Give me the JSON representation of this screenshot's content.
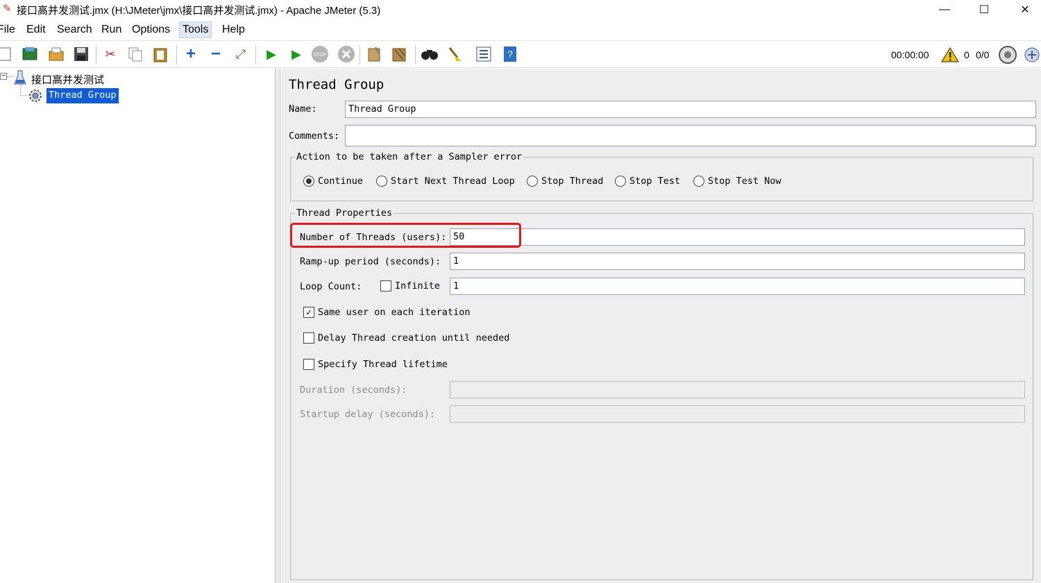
{
  "window": {
    "title": "接口高并发测试.jmx (H:\\JMeter\\jmx\\接口高并发测试.jmx) - Apache JMeter (5.3)",
    "minimize_glyph": "—",
    "maximize_glyph": "☐",
    "close_glyph": "✕"
  },
  "menu": {
    "items": [
      "File",
      "Edit",
      "Search",
      "Run",
      "Options",
      "Tools",
      "Help"
    ],
    "active": "Tools"
  },
  "toolbar": {
    "icons": [
      "new-icon",
      "templates-icon",
      "open-icon",
      "save-icon",
      "cut-icon",
      "copy-icon",
      "paste-icon",
      "expand-icon",
      "collapse-icon",
      "toggle-icon",
      "start-icon",
      "start-no-pauses-icon",
      "stop-icon",
      "shutdown-icon",
      "clear-icon",
      "clear-all-icon",
      "search-icon",
      "reset-search-icon",
      "function-helper-icon",
      "help-icon"
    ],
    "timer": "00:00:00",
    "warning_count": "0",
    "threads_ratio": "0/0",
    "accent_play": "#1a9b1a",
    "accent_add": "#1f5fbf"
  },
  "tree": {
    "root_label": "接口高并发测试",
    "child_label": "Thread Group",
    "selection_color": "#0f5cd6",
    "expander": "−"
  },
  "panel": {
    "heading": "Thread Group",
    "name_label": "Name:",
    "name_value": "Thread Group",
    "comments_label": "Comments:",
    "comments_value": "",
    "sampler_error": {
      "legend": "Action to be taken after a Sampler error",
      "options": [
        "Continue",
        "Start Next Thread Loop",
        "Stop Thread",
        "Stop Test",
        "Stop Test Now"
      ],
      "selected": "Continue"
    },
    "thread_props": {
      "legend": "Thread Properties",
      "num_threads_label": "Number of Threads (users):",
      "num_threads_value": "50",
      "rampup_label": "Ramp-up period (seconds):",
      "rampup_value": "1",
      "loop_label": "Loop Count:",
      "infinite_label": "Infinite",
      "infinite_checked": false,
      "loop_value": "1",
      "same_user_label": "Same user on each iteration",
      "same_user_checked": true,
      "delay_label": "Delay Thread creation until needed",
      "delay_checked": false,
      "lifetime_label": "Specify Thread lifetime",
      "lifetime_checked": false,
      "duration_label": "Duration (seconds):",
      "duration_value": "",
      "startup_label": "Startup delay (seconds):",
      "startup_value": ""
    },
    "highlight_color": "#e01919"
  }
}
